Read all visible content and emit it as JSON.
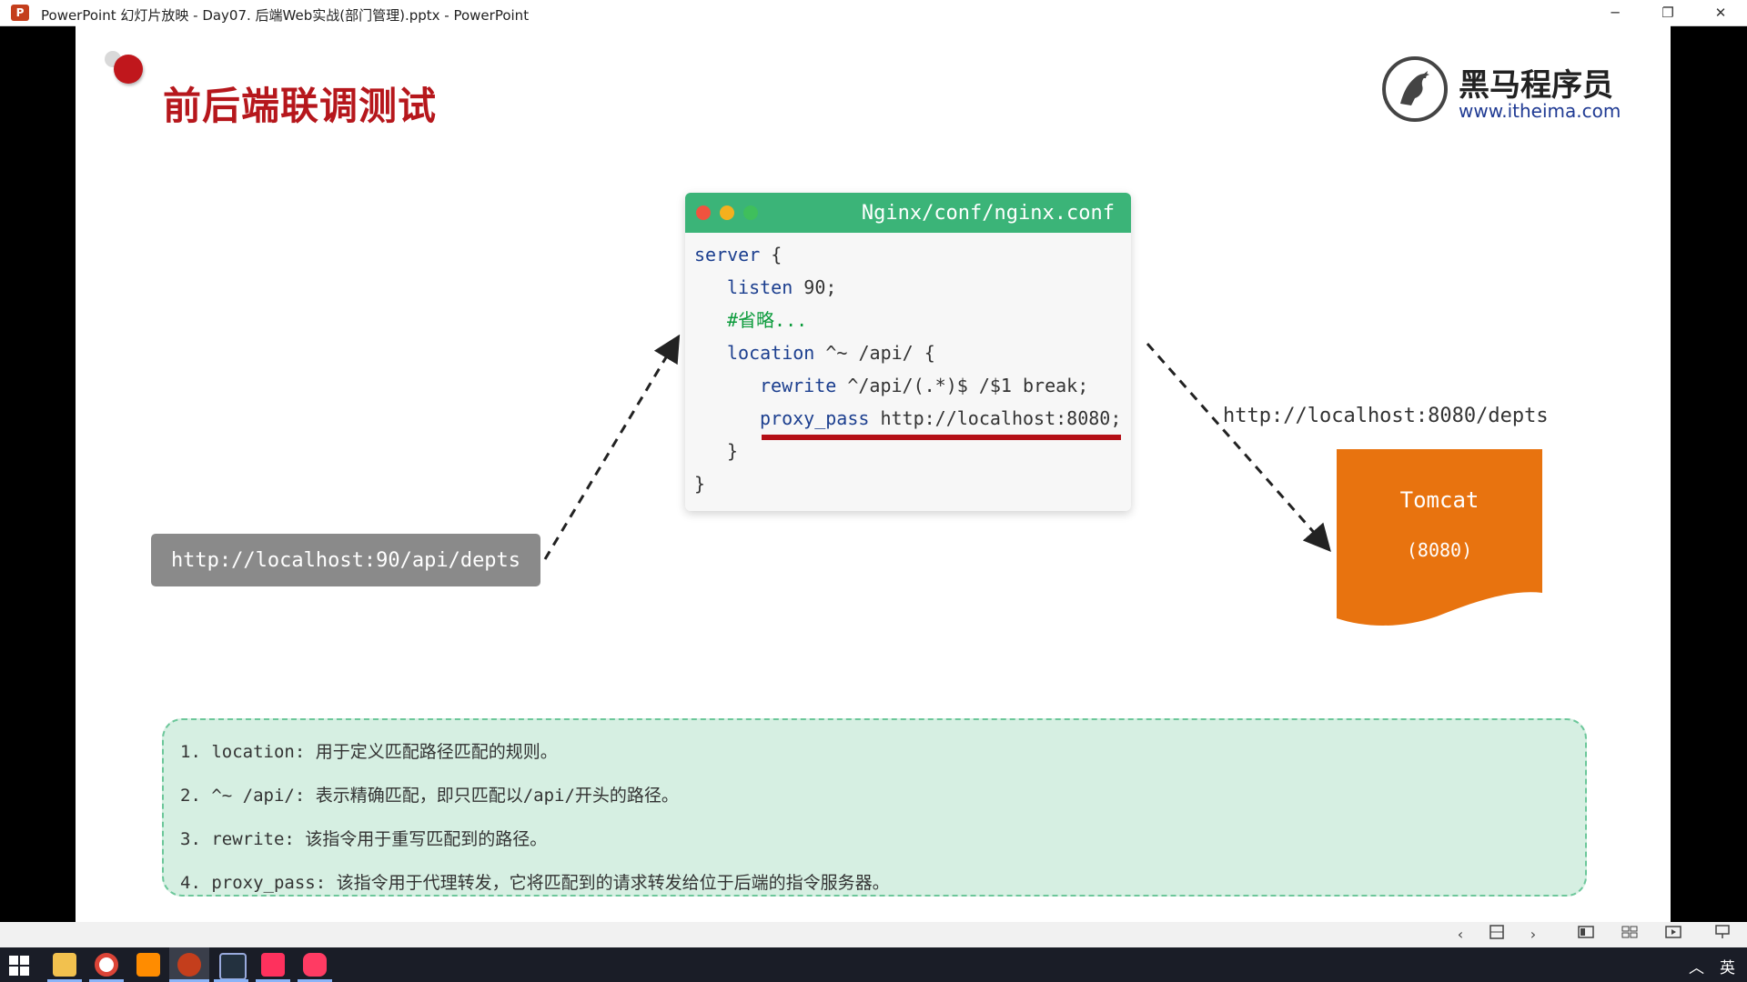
{
  "window": {
    "title": "PowerPoint 幻灯片放映  -  Day07. 后端Web实战(部门管理).pptx - PowerPoint",
    "app_icon": "P",
    "minimize_icon": "─",
    "restore_icon": "❐",
    "close_icon": "✕"
  },
  "slide": {
    "title": "前后端联调测试",
    "logo": {
      "name": "黑马程序员",
      "url": "www.itheima.com"
    },
    "code_window": {
      "title": "Nginx/conf/nginx.conf",
      "lines": [
        {
          "kw": "server",
          "rest": " {"
        },
        {
          "kw": "listen",
          "rest": " 90;"
        },
        {
          "comment": "#省略..."
        },
        {
          "kw": "location",
          "rest": " ^~ /api/ {"
        },
        {
          "kw": "rewrite",
          "rest": " ^/api/(.*)$ /$1 break;"
        },
        {
          "kw": "proxy_pass",
          "rest": " http://localhost:8080;"
        },
        {
          "rest": "}"
        },
        {
          "rest": "}"
        }
      ]
    },
    "request_url": "http://localhost:90/api/depts",
    "target_url": "http://localhost:8080/depts",
    "tomcat": {
      "name": "Tomcat",
      "port": "(8080)"
    },
    "notes": [
      "1. location: 用于定义匹配路径匹配的规则。",
      "2. ^~ /api/: 表示精确匹配，即只匹配以/api/开头的路径。",
      "3. rewrite: 该指令用于重写匹配到的路径。",
      "4. proxy_pass: 该指令用于代理转发，它将匹配到的请求转发给位于后端的指令服务器。"
    ],
    "colors": {
      "title": "#b6171c",
      "code_header": "#3bb478",
      "tomcat": "#e8730f",
      "notes_bg": "#d6efe2"
    }
  },
  "slideshow_controls": {
    "prev_icon": "‹",
    "next_icon": "›"
  },
  "taskbar": {
    "ime": "英",
    "tray_up_icon": "︿"
  }
}
